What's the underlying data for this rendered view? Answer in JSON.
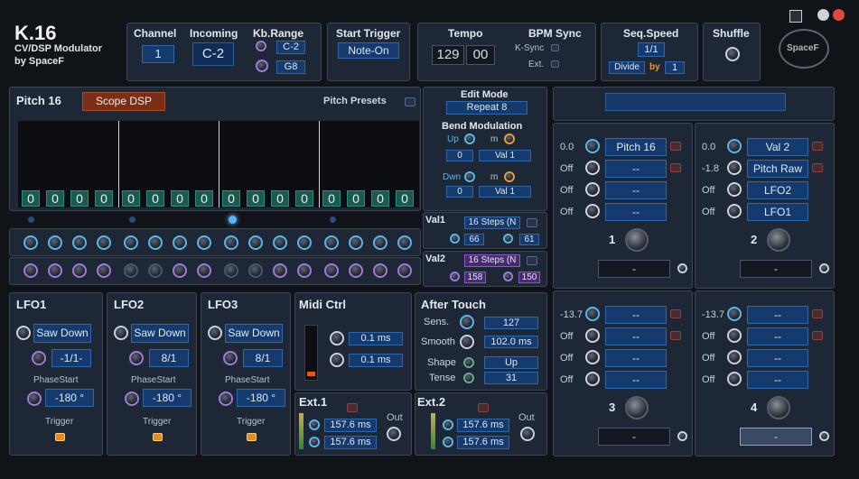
{
  "app": {
    "title": "K.16",
    "subtitle": "CV/DSP Modulator",
    "author": "by SpaceF",
    "logo": "SpaceF"
  },
  "channel": {
    "label": "Channel",
    "value": "1"
  },
  "incoming": {
    "label": "Incoming",
    "value": "C-2"
  },
  "kbrange": {
    "label": "Kb.Range",
    "low": "C-2",
    "high": "G8"
  },
  "start_trigger": {
    "label": "Start Trigger",
    "value": "Note-On"
  },
  "tempo": {
    "label": "Tempo",
    "value": "129",
    "frac": "00"
  },
  "bpm_sync": {
    "label": "BPM Sync",
    "ksync": "K-Sync",
    "ext": "Ext."
  },
  "seq_speed": {
    "label": "Seq.Speed",
    "value": "1/1",
    "divide": "Divide",
    "by": "by",
    "by_value": "1"
  },
  "shuffle": {
    "label": "Shuffle"
  },
  "pitch": {
    "title": "Pitch 16",
    "scope_button": "Scope DSP",
    "presets_label": "Pitch Presets",
    "values": [
      "0",
      "0",
      "0",
      "0",
      "0",
      "0",
      "0",
      "0",
      "0",
      "0",
      "0",
      "0",
      "0",
      "0",
      "0",
      "0"
    ]
  },
  "edit_mode": {
    "label": "Edit Mode",
    "value": "Repeat 8"
  },
  "bend": {
    "label": "Bend Modulation",
    "up": "Up",
    "dwn": "Dwn",
    "m": "m",
    "up_value": "0",
    "up_target": "Val 1",
    "dwn_value": "0",
    "dwn_target": "Val 1"
  },
  "val1": {
    "label": "Val1",
    "steps": "16 Steps (N",
    "a": "66",
    "b": "61"
  },
  "val2": {
    "label": "Val2",
    "steps": "16 Steps (N",
    "a": "158",
    "b": "150"
  },
  "lfo1": {
    "label": "LFO1",
    "wave": "Saw Down",
    "rate": "-1/1-",
    "phase_label": "PhaseStart",
    "phase": "-180 °",
    "trigger": "Trigger"
  },
  "lfo2": {
    "label": "LFO2",
    "wave": "Saw Down",
    "rate": "8/1",
    "phase_label": "PhaseStart",
    "phase": "-180 °",
    "trigger": "Trigger"
  },
  "lfo3": {
    "label": "LFO3",
    "wave": "Saw Down",
    "rate": "8/1",
    "phase_label": "PhaseStart",
    "phase": "-180 °",
    "trigger": "Trigger"
  },
  "midi_ctrl": {
    "label": "Midi Ctrl",
    "a": "0.1 ms",
    "b": "0.1 ms"
  },
  "after_touch": {
    "label": "After Touch",
    "sens_label": "Sens.",
    "sens": "127",
    "smooth_label": "Smooth",
    "smooth": "102.0 ms",
    "shape_label": "Shape",
    "shape": "Up",
    "tense_label": "Tense",
    "tense": "31"
  },
  "ext1": {
    "label": "Ext.1",
    "a": "157.6 ms",
    "b": "157.6 ms",
    "out": "Out"
  },
  "ext2": {
    "label": "Ext.2",
    "a": "157.6 ms",
    "b": "157.6 ms",
    "out": "Out"
  },
  "mixers": [
    {
      "number": "1",
      "rows": [
        {
          "v": "0.0",
          "t": "Pitch 16"
        },
        {
          "v": "Off",
          "t": "--"
        },
        {
          "v": "Off",
          "t": "--"
        },
        {
          "v": "Off",
          "t": "--"
        }
      ],
      "output": "-"
    },
    {
      "number": "2",
      "rows": [
        {
          "v": "0.0",
          "t": "Val 2"
        },
        {
          "v": "-1.8",
          "t": "Pitch Raw"
        },
        {
          "v": "Off",
          "t": "LFO2"
        },
        {
          "v": "Off",
          "t": "LFO1"
        }
      ],
      "output": "-"
    },
    {
      "number": "3",
      "rows": [
        {
          "v": "-13.7",
          "t": "--"
        },
        {
          "v": "Off",
          "t": "--"
        },
        {
          "v": "Off",
          "t": "--"
        },
        {
          "v": "Off",
          "t": "--"
        }
      ],
      "output": "-"
    },
    {
      "number": "4",
      "rows": [
        {
          "v": "-13.7",
          "t": "--"
        },
        {
          "v": "Off",
          "t": "--"
        },
        {
          "v": "Off",
          "t": "--"
        },
        {
          "v": "Off",
          "t": "--"
        }
      ],
      "output": "-"
    }
  ],
  "colors": {
    "lcd": "#143a6e",
    "panel": "#1d2736",
    "accent": "#59b6e8",
    "led": "#e38b1e"
  }
}
